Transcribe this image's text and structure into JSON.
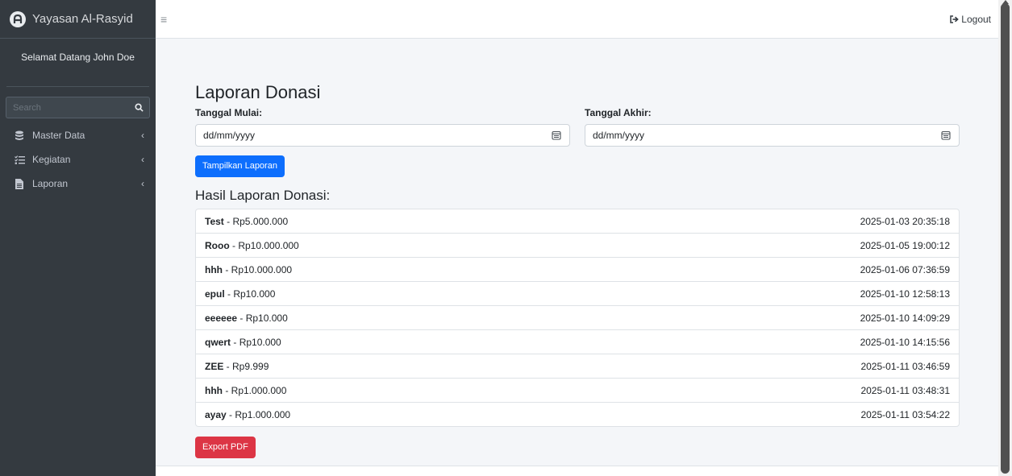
{
  "brand": {
    "title": "Yayasan Al-Rasyid",
    "logo_icon": "brand-logo-icon"
  },
  "user_panel": {
    "greeting": "Selamat Datang John Doe"
  },
  "search": {
    "placeholder": "Search",
    "icon": "search-icon"
  },
  "sidebar": {
    "items": [
      {
        "label": "Master Data",
        "icon": "database-icon"
      },
      {
        "label": "Kegiatan",
        "icon": "list-check-icon"
      },
      {
        "label": "Laporan",
        "icon": "file-icon"
      }
    ],
    "chevron": "‹"
  },
  "topbar": {
    "menu_icon": "≡",
    "logout_label": "Logout"
  },
  "main": {
    "title": "Laporan Donasi",
    "start_label": "Tanggal Mulai:",
    "end_label": "Tanggal Akhir:",
    "start_placeholder": "dd/mm/yyyy",
    "end_placeholder": "dd/mm/yyyy",
    "show_button": "Tampilkan Laporan",
    "result_title": "Hasil Laporan Donasi:",
    "export_button": "Export PDF"
  },
  "donations": [
    {
      "name": "Test",
      "amount": "Rp5.000.000",
      "timestamp": "2025-01-03 20:35:18"
    },
    {
      "name": "Rooo",
      "amount": "Rp10.000.000",
      "timestamp": "2025-01-05 19:00:12"
    },
    {
      "name": "hhh",
      "amount": "Rp10.000.000",
      "timestamp": "2025-01-06 07:36:59"
    },
    {
      "name": "epul",
      "amount": "Rp10.000",
      "timestamp": "2025-01-10 12:58:13"
    },
    {
      "name": "eeeeee",
      "amount": "Rp10.000",
      "timestamp": "2025-01-10 14:09:29"
    },
    {
      "name": "qwert",
      "amount": "Rp10.000",
      "timestamp": "2025-01-10 14:15:56"
    },
    {
      "name": "ZEE",
      "amount": "Rp9.999",
      "timestamp": "2025-01-11 03:46:59"
    },
    {
      "name": "hhh",
      "amount": "Rp1.000.000",
      "timestamp": "2025-01-11 03:48:31"
    },
    {
      "name": "ayay",
      "amount": "Rp1.000.000",
      "timestamp": "2025-01-11 03:54:22"
    }
  ],
  "colors": {
    "sidebar": "#343a40",
    "primary": "#0d6efd",
    "danger": "#dc3545"
  }
}
